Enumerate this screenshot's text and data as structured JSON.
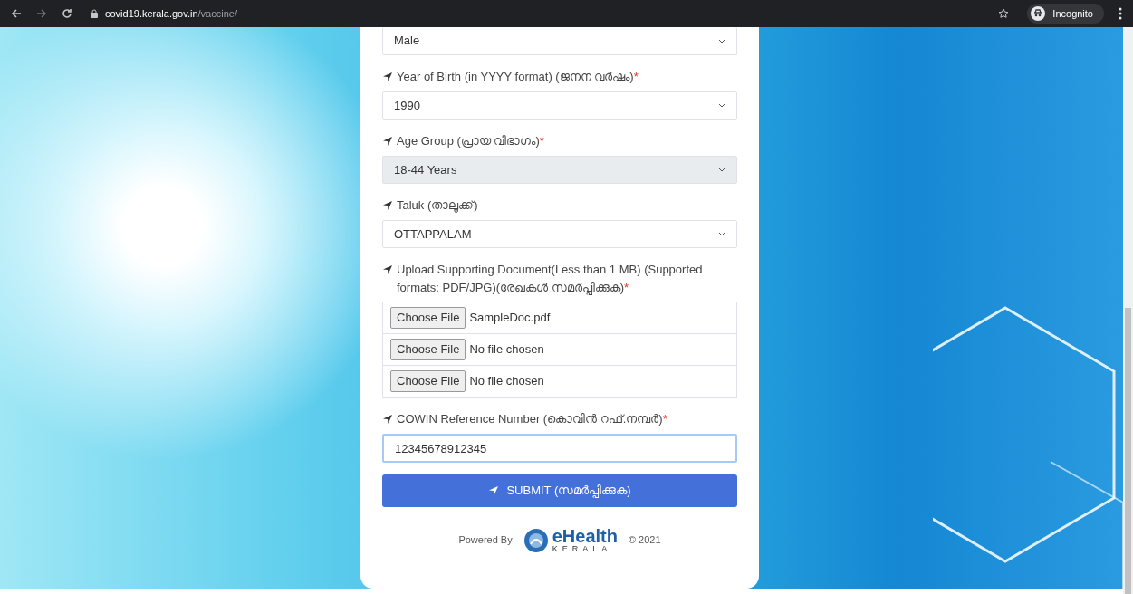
{
  "browser": {
    "url_host": "covid19.kerala.gov.in",
    "url_path": "/vaccine/",
    "profile": "Incognito"
  },
  "form": {
    "fields": [
      {
        "kind": "select",
        "value": "Male",
        "disabled": false
      },
      {
        "kind": "select",
        "label": "Year of Birth (in YYYY format) (ജനന വർഷം)",
        "required_mark": "*",
        "value": "1990",
        "disabled": false
      },
      {
        "kind": "select",
        "label": "Age Group (പ്രായ വിഭാഗം)",
        "required_mark": "*",
        "value": "18-44 Years",
        "disabled": true
      },
      {
        "kind": "select",
        "label": "Taluk (താലൂക്ക്)",
        "value": "OTTAPPALAM",
        "disabled": false
      },
      {
        "kind": "file",
        "label": "Upload Supporting Document(Less than 1 MB) (Supported formats: PDF/JPG)(രേഖകൾ സമർപ്പിക്കുക)",
        "required_mark": "*",
        "files": [
          {
            "button": "Choose File",
            "name": "SampleDoc.pdf"
          },
          {
            "button": "Choose File",
            "name": "No file chosen"
          },
          {
            "button": "Choose File",
            "name": "No file chosen"
          }
        ]
      },
      {
        "kind": "text",
        "label": "COWIN Reference Number (കൊവിൻ റഫ്.നമ്പർ)",
        "required_mark": "*",
        "value": "12345678912345",
        "focused": true
      }
    ],
    "submit": "SUBMIT (സമർപ്പിക്കുക)"
  },
  "footer": {
    "powered_by": "Powered By",
    "logo_title": "eHealth",
    "logo_subtitle": "KERALA",
    "copyright": "© 2021"
  }
}
